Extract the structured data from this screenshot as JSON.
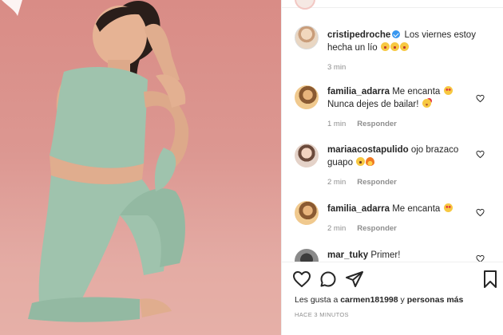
{
  "post": {
    "author": "cristipedroche",
    "verified": true,
    "caption_text": "Los viernes estoy hecha un lío",
    "caption_emojis": [
      "laugh",
      "laugh",
      "laugh"
    ],
    "caption_time": "3 min"
  },
  "comments": [
    {
      "user": "familia_adarra",
      "text_line1": "Me encanta",
      "text_line2": "Nunca dejes de bailar!",
      "time": "1 min",
      "reply_label": "Responder"
    },
    {
      "user": "mariaacostapulido",
      "text_line1": "ojo brazaco",
      "text_line2": "guapo",
      "time": "2 min",
      "reply_label": "Responder"
    },
    {
      "user": "familia_adarra",
      "text_line1": "Me encanta",
      "time": "2 min",
      "reply_label": "Responder"
    },
    {
      "user": "mar_tuky",
      "text_line1": "Primer!"
    }
  ],
  "likes": {
    "prefix": "Les gusta a",
    "user": "carmen181998",
    "middle": "y",
    "suffix": "personas más"
  },
  "posted_ago": "HACE 3 MINUTOS",
  "icons": {
    "like": "heart-outline-icon",
    "comment": "comment-bubble-icon",
    "share": "paper-plane-icon",
    "save": "bookmark-icon",
    "verified": "verified-badge-icon"
  },
  "colors": {
    "verified_blue": "#3897f0",
    "meta_gray": "#8e8e8e",
    "photo_background": "#dc9791",
    "outfit_green": "#9fc3ad"
  }
}
